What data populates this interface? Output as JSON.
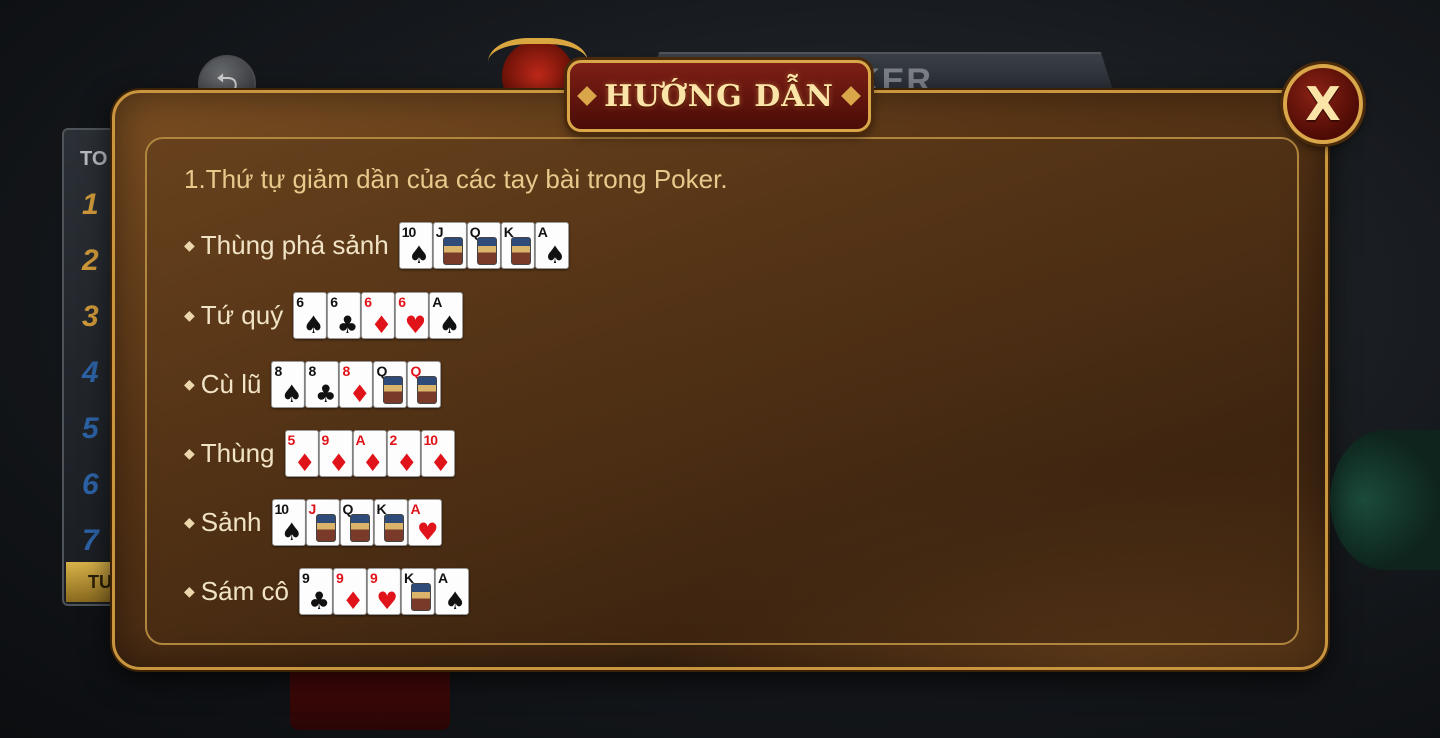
{
  "background": {
    "back_icon": "back-arrow-icon",
    "title_partial": "KER",
    "leaderboard": {
      "header": "TO",
      "ranks": [
        "1",
        "2",
        "3",
        "4",
        "5",
        "6",
        "7"
      ],
      "footer": "TU"
    }
  },
  "dialog": {
    "title": "HƯỚNG DẪN",
    "close_label": "X",
    "intro": "1.Thứ tự giảm dần của các tay bài trong Poker.",
    "hands": [
      {
        "name": "Thùng phá sảnh",
        "cards": [
          {
            "rank": "10",
            "suit": "♠",
            "color": "black",
            "face": false
          },
          {
            "rank": "J",
            "suit": "♠",
            "color": "black",
            "face": true
          },
          {
            "rank": "Q",
            "suit": "♠",
            "color": "black",
            "face": true
          },
          {
            "rank": "K",
            "suit": "♠",
            "color": "black",
            "face": true
          },
          {
            "rank": "A",
            "suit": "♠",
            "color": "black",
            "face": false
          }
        ]
      },
      {
        "name": "Tứ quý",
        "cards": [
          {
            "rank": "6",
            "suit": "♠",
            "color": "black",
            "face": false
          },
          {
            "rank": "6",
            "suit": "♣",
            "color": "black",
            "face": false
          },
          {
            "rank": "6",
            "suit": "♦",
            "color": "red",
            "face": false
          },
          {
            "rank": "6",
            "suit": "♥",
            "color": "red",
            "face": false
          },
          {
            "rank": "A",
            "suit": "♠",
            "color": "black",
            "face": false
          }
        ]
      },
      {
        "name": "Cù lũ",
        "cards": [
          {
            "rank": "8",
            "suit": "♠",
            "color": "black",
            "face": false
          },
          {
            "rank": "8",
            "suit": "♣",
            "color": "black",
            "face": false
          },
          {
            "rank": "8",
            "suit": "♦",
            "color": "red",
            "face": false
          },
          {
            "rank": "Q",
            "suit": "♠",
            "color": "black",
            "face": true
          },
          {
            "rank": "Q",
            "suit": "♦",
            "color": "red",
            "face": true
          }
        ]
      },
      {
        "name": "Thùng",
        "cards": [
          {
            "rank": "5",
            "suit": "♦",
            "color": "red",
            "face": false
          },
          {
            "rank": "9",
            "suit": "♦",
            "color": "red",
            "face": false
          },
          {
            "rank": "A",
            "suit": "♦",
            "color": "red",
            "face": false
          },
          {
            "rank": "2",
            "suit": "♦",
            "color": "red",
            "face": false
          },
          {
            "rank": "10",
            "suit": "♦",
            "color": "red",
            "face": false
          }
        ]
      },
      {
        "name": "Sảnh",
        "cards": [
          {
            "rank": "10",
            "suit": "♠",
            "color": "black",
            "face": false
          },
          {
            "rank": "J",
            "suit": "♦",
            "color": "red",
            "face": true
          },
          {
            "rank": "Q",
            "suit": "♠",
            "color": "black",
            "face": true
          },
          {
            "rank": "K",
            "suit": "♠",
            "color": "black",
            "face": true
          },
          {
            "rank": "A",
            "suit": "♥",
            "color": "red",
            "face": false
          }
        ]
      },
      {
        "name": "Sám cô",
        "cards": [
          {
            "rank": "9",
            "suit": "♣",
            "color": "black",
            "face": false
          },
          {
            "rank": "9",
            "suit": "♦",
            "color": "red",
            "face": false
          },
          {
            "rank": "9",
            "suit": "♥",
            "color": "red",
            "face": false
          },
          {
            "rank": "K",
            "suit": "♠",
            "color": "black",
            "face": true
          },
          {
            "rank": "A",
            "suit": "♠",
            "color": "black",
            "face": false
          }
        ]
      }
    ]
  }
}
